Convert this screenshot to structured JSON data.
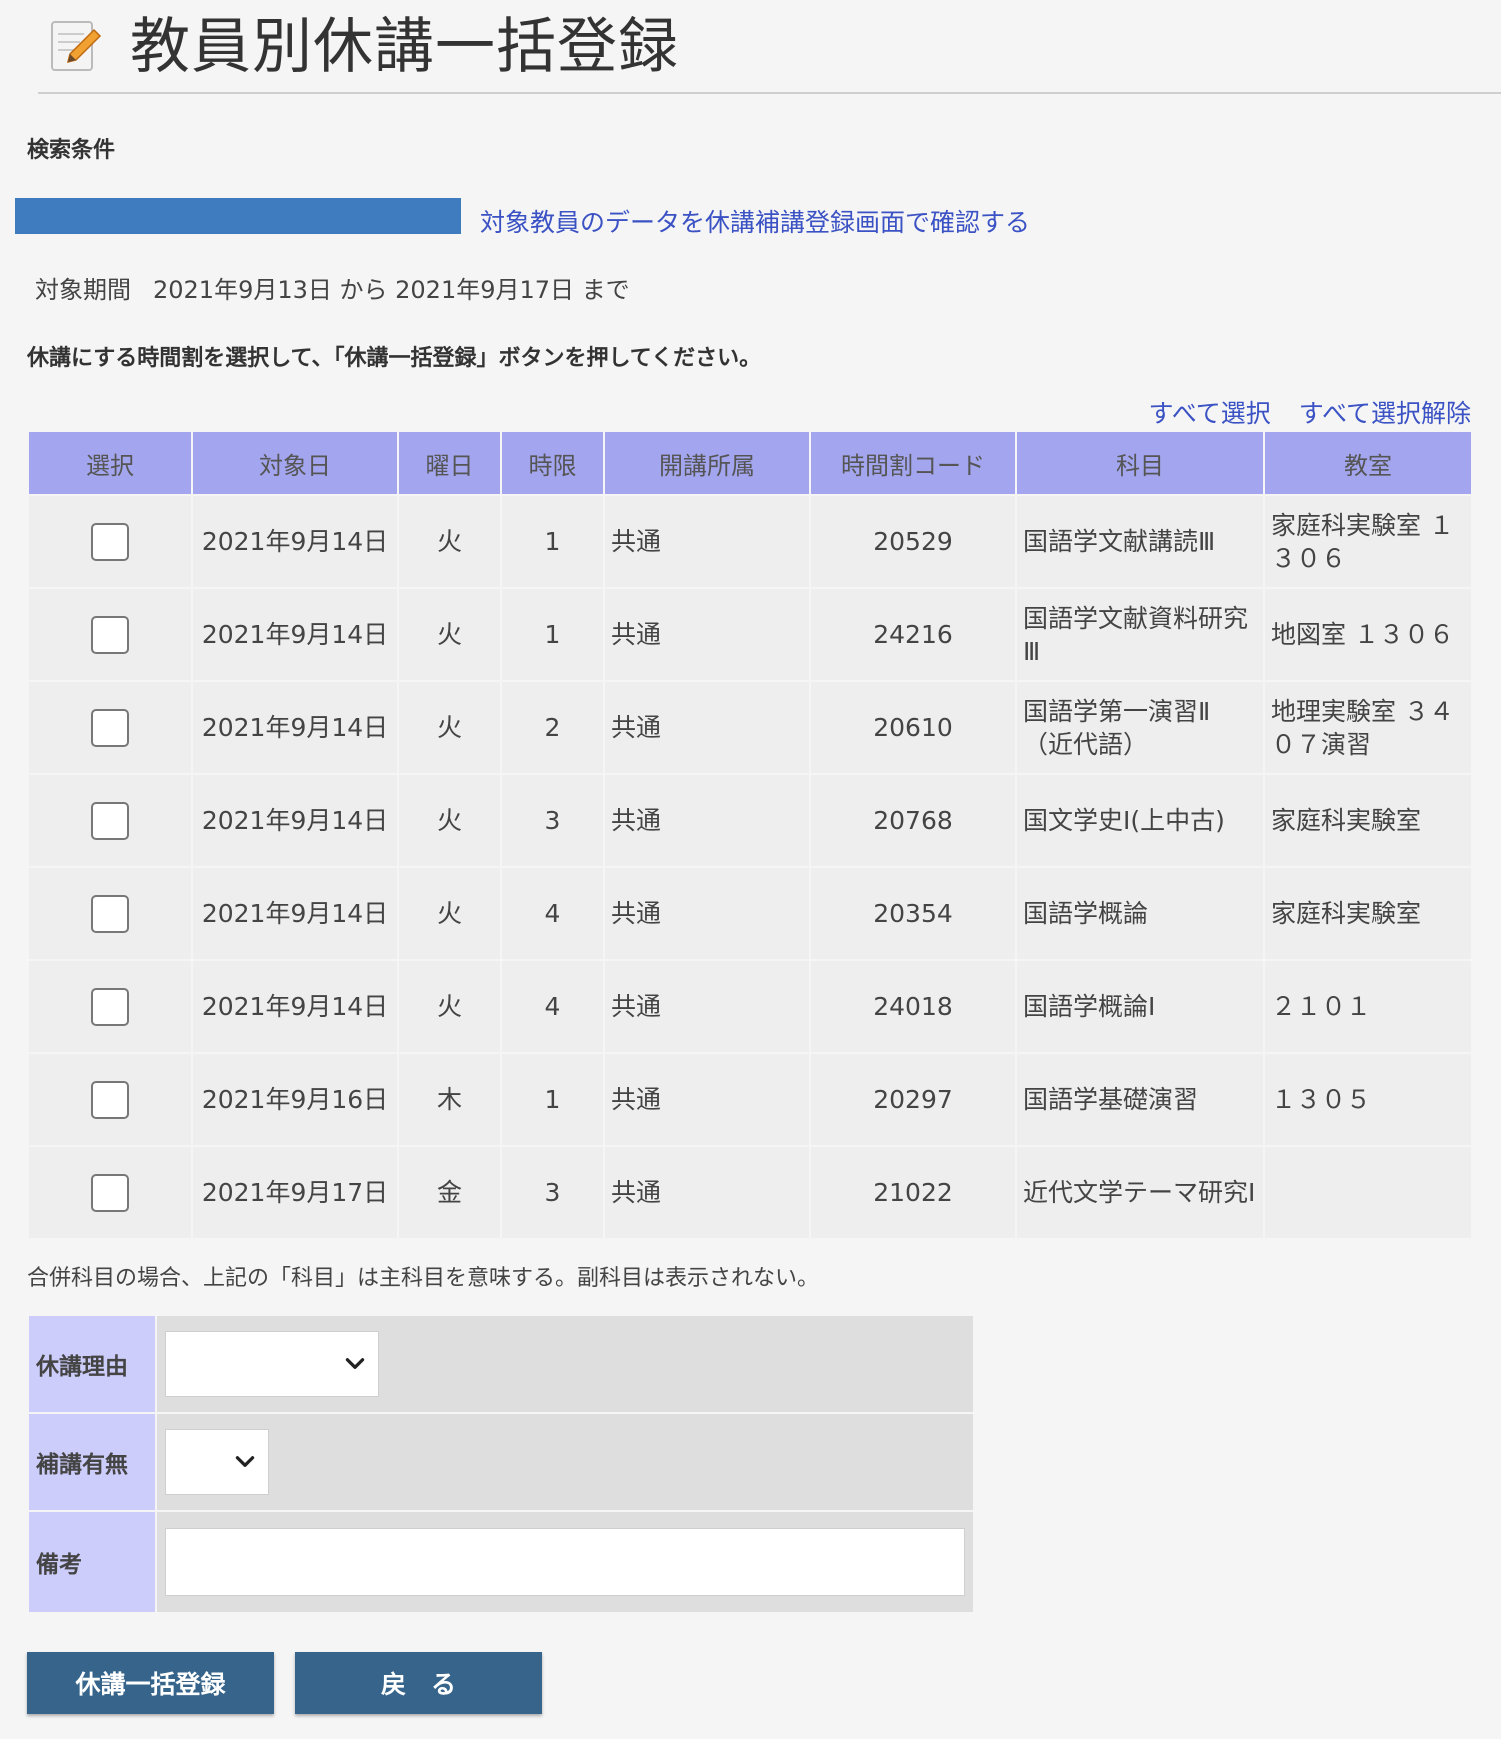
{
  "page_title": "教員別休講一括登録",
  "search": {
    "section_label": "検索条件",
    "confirm_link": "対象教員のデータを休講補講登録画面で確認する",
    "period_label": "対象期間",
    "period_text": "2021年9月13日 から 2021年9月17日 まで"
  },
  "instruction": "休講にする時間割を選択して、「休講一括登録」ボタンを押してください。",
  "links": {
    "select_all": "すべて選択",
    "deselect_all": "すべて選択解除"
  },
  "table": {
    "headers": [
      "選択",
      "対象日",
      "曜日",
      "時限",
      "開講所属",
      "時間割コード",
      "科目",
      "教室"
    ],
    "rows": [
      {
        "date": "2021年9月14日",
        "day": "火",
        "period": "1",
        "dept": "共通",
        "code": "20529",
        "subject": "国語学文献講読Ⅲ",
        "room": "家庭科実験室 １３０６"
      },
      {
        "date": "2021年9月14日",
        "day": "火",
        "period": "1",
        "dept": "共通",
        "code": "24216",
        "subject": "国語学文献資料研究Ⅲ",
        "room": "地図室 １３０６"
      },
      {
        "date": "2021年9月14日",
        "day": "火",
        "period": "2",
        "dept": "共通",
        "code": "20610",
        "subject": "国語学第一演習Ⅱ（近代語）",
        "room": "地理実験室 ３４０７演習"
      },
      {
        "date": "2021年9月14日",
        "day": "火",
        "period": "3",
        "dept": "共通",
        "code": "20768",
        "subject": "国文学史Ⅰ(上中古)",
        "room": "家庭科実験室"
      },
      {
        "date": "2021年9月14日",
        "day": "火",
        "period": "4",
        "dept": "共通",
        "code": "20354",
        "subject": "国語学概論",
        "room": "家庭科実験室"
      },
      {
        "date": "2021年9月14日",
        "day": "火",
        "period": "4",
        "dept": "共通",
        "code": "24018",
        "subject": "国語学概論Ⅰ",
        "room": "２１０１"
      },
      {
        "date": "2021年9月16日",
        "day": "木",
        "period": "1",
        "dept": "共通",
        "code": "20297",
        "subject": "国語学基礎演習",
        "room": "１３０５"
      },
      {
        "date": "2021年9月17日",
        "day": "金",
        "period": "3",
        "dept": "共通",
        "code": "21022",
        "subject": "近代文学テーマ研究Ⅰ",
        "room": ""
      }
    ]
  },
  "note": "合併科目の場合、上記の「科目」は主科目を意味する。副科目は表示されない。",
  "form": {
    "reason_label": "休講理由",
    "reason_value": "",
    "makeup_label": "補講有無",
    "makeup_value": "",
    "remarks_label": "備考",
    "remarks_value": ""
  },
  "buttons": {
    "register": "休講一括登録",
    "back": "戻　る"
  },
  "colors": {
    "header_bg": "#a3a6ee",
    "form_label_bg": "#cdcdfb",
    "button_bg": "#36648b",
    "link": "#3b52c4",
    "teacher_bar": "#3f7bbf"
  }
}
